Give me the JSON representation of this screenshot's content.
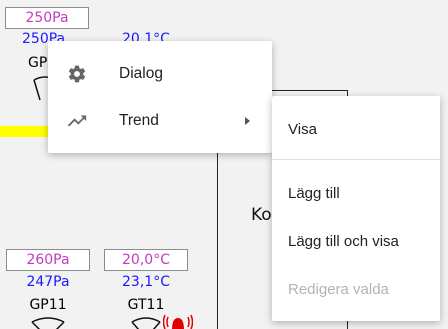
{
  "background": {
    "top_left": {
      "setpoint": "250Pa",
      "pressure": "250Pa",
      "temperature": "20,1°C",
      "tag": "GP"
    },
    "bottom_left": {
      "gp_setpoint": "260Pa",
      "gp_value": "247Pa",
      "gp_tag": "GP11",
      "gt_setpoint": "20,0°C",
      "gt_value": "23,1°C",
      "gt_tag": "GT11"
    },
    "unit_label": "Ko",
    "colors": {
      "setpoint_text": "#c23cc2",
      "value_text": "#1a1aff",
      "pipe": "#ffff00",
      "alarm": "#e00000"
    }
  },
  "context_menu": {
    "items": [
      {
        "label": "Dialog",
        "icon": "gear-icon"
      },
      {
        "label": "Trend",
        "icon": "trend-icon",
        "has_submenu": true
      }
    ]
  },
  "submenu": {
    "items": [
      {
        "label": "Visa",
        "enabled": true
      },
      {
        "label": "Lägg till",
        "enabled": true
      },
      {
        "label": "Lägg till och visa",
        "enabled": true
      },
      {
        "label": "Redigera valda",
        "enabled": false
      }
    ]
  }
}
